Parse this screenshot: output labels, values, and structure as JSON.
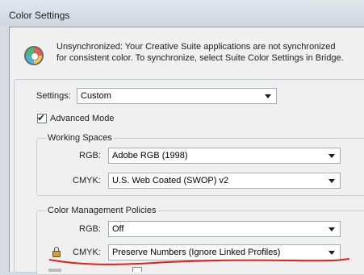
{
  "window": {
    "title": "Color Settings"
  },
  "sync": {
    "icon": "color-wheel-icon",
    "message": "Unsynchronized: Your Creative Suite applications are not synchronized for consistent color. To synchronize, select Suite Color Settings in Bridge."
  },
  "settings": {
    "label": "Settings:",
    "value": "Custom"
  },
  "advanced_mode": {
    "label": "Advanced Mode",
    "checked": true,
    "check_glyph": "✔"
  },
  "working_spaces": {
    "title": "Working Spaces",
    "rgb": {
      "label": "RGB:",
      "value": "Adobe RGB (1998)"
    },
    "cmyk": {
      "label": "CMYK:",
      "value": "U.S. Web Coated (SWOP) v2"
    }
  },
  "policies": {
    "title": "Color Management Policies",
    "rgb": {
      "label": "RGB:",
      "value": "Off"
    },
    "cmyk": {
      "label": "CMYK:",
      "value": "Preserve Numbers (Ignore Linked Profiles)"
    },
    "lock_icon": "lock-icon"
  },
  "colors": {
    "annotation": "#e0201b",
    "window_bg": "#f0f0f0",
    "titlebar": "#d6dbe2"
  }
}
